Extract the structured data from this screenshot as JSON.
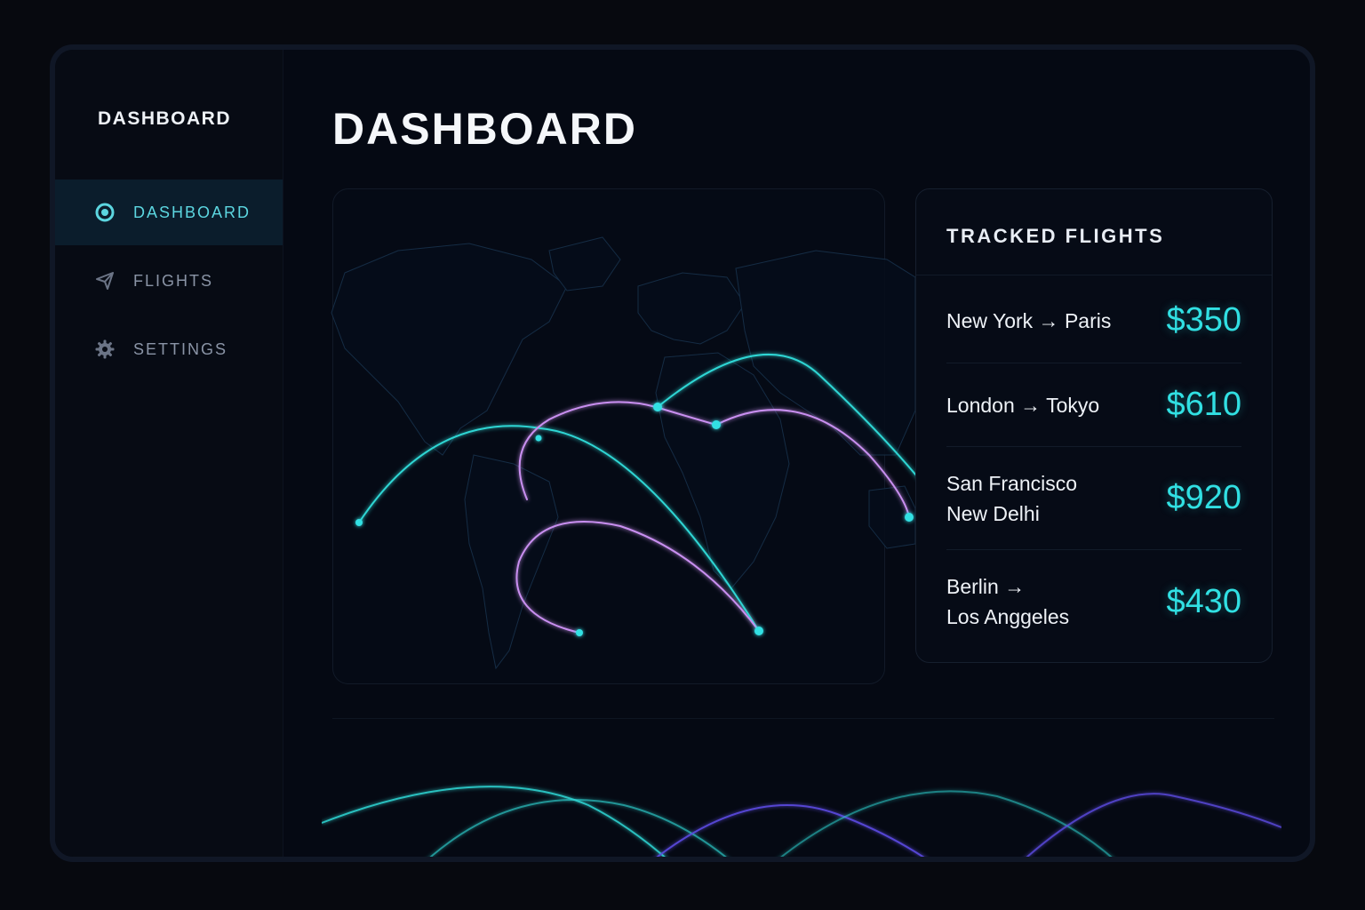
{
  "sidebar": {
    "brand": "DASHBOARD",
    "items": [
      {
        "label": "DASHBOARD",
        "icon": "radio-circle-icon",
        "active": true
      },
      {
        "label": "FLIGHTS",
        "icon": "plane-icon",
        "active": false
      },
      {
        "label": "SETTINGS",
        "icon": "gear-icon",
        "active": false
      }
    ]
  },
  "main": {
    "title": "DASHBOARD"
  },
  "tracked_flights": {
    "title": "TRACKED FLIGHTS",
    "rows": [
      {
        "line1": "New York → Paris",
        "line2": "",
        "price": "$350"
      },
      {
        "line1": "London → Tokyo",
        "line2": "",
        "price": "$610"
      },
      {
        "line1": "San Francisco",
        "line2": "New Delhi",
        "price": "$920"
      },
      {
        "line1": "Berlin →",
        "line2": "Los Anggeles",
        "price": "$430"
      }
    ]
  },
  "colors": {
    "accent_cyan": "#31e0e3",
    "accent_purple": "#c98ff0",
    "accent_violet": "#5b4ae0",
    "background": "#050913"
  }
}
